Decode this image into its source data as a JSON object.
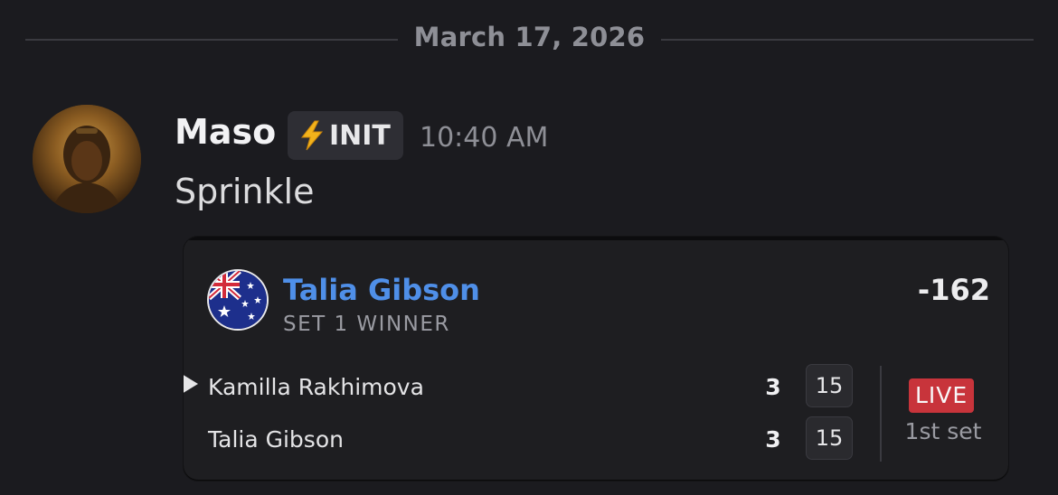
{
  "divider": {
    "date": "March 17, 2026"
  },
  "message": {
    "author": "Maso",
    "role_badge": {
      "icon": "lightning-bolt-icon",
      "label": "INIT"
    },
    "timestamp": "10:40 AM",
    "text": "Sprinkle"
  },
  "card": {
    "flag_icon": "australia-flag-icon",
    "pick": "Talia Gibson",
    "market": "SET 1 WINNER",
    "odds": "-162",
    "players": [
      {
        "name": "Kamilla Rakhimova",
        "sets": "3",
        "games": "15",
        "serving": true
      },
      {
        "name": "Talia Gibson",
        "sets": "3",
        "games": "15",
        "serving": false
      }
    ],
    "status": {
      "badge": "LIVE",
      "period": "1st set"
    }
  },
  "colors": {
    "background": "#1b1b1f",
    "pick_name": "#4f8fe8",
    "live_badge": "#c8343b",
    "bolt": "#f2b21b"
  }
}
